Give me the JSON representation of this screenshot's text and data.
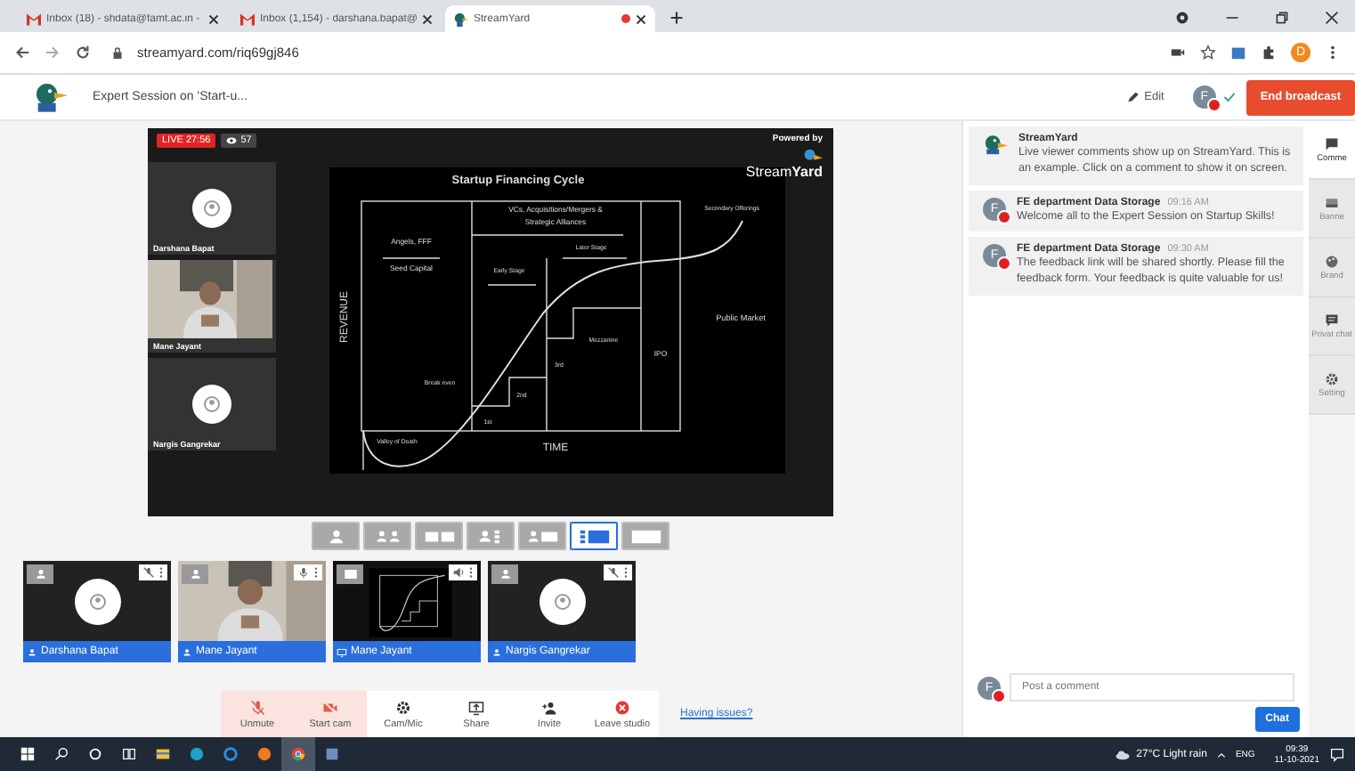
{
  "browser": {
    "tabs": [
      {
        "title": "Inbox (18) - shdata@famt.ac.in -",
        "kind": "mail",
        "selected": false,
        "recording": false
      },
      {
        "title": "Inbox (1,154) - darshana.bapat@",
        "kind": "mail",
        "selected": false,
        "recording": false
      },
      {
        "title": "StreamYard",
        "kind": "duck",
        "selected": true,
        "recording": true
      }
    ],
    "url": "streamyard.com/riq69gj846",
    "profile": "D"
  },
  "header": {
    "title": "Expert Session on 'Start-u...",
    "edit": "Edit",
    "avatar_initial": "F",
    "end_button": "End broadcast"
  },
  "stage": {
    "live": "LIVE 27:56",
    "viewers": "57",
    "powered_by": "Powered by",
    "brand": "Stream**Yard**",
    "participants": [
      {
        "name": "Darshana Bapat",
        "kind": "avatar"
      },
      {
        "name": "Mane Jayant",
        "kind": "video"
      },
      {
        "name": "Nargis Gangrekar",
        "kind": "avatar"
      }
    ],
    "slide": [
      "Startup Financing Cycle",
      "VCs, Acquisitions/Mergers &",
      "Strategic Alliances",
      "Angels, FFF",
      "Seed Capital",
      "Later Stage",
      "Early Stage",
      "REVENUE",
      "Secondary Offerings",
      "Public Market",
      "Mezzanine",
      "IPO",
      "3rd",
      "2nd",
      "Break even",
      "1st",
      "Valley of Death",
      "TIME"
    ]
  },
  "layouts": [
    {
      "kind": "solo",
      "selected": false
    },
    {
      "kind": "group",
      "selected": false
    },
    {
      "kind": "split",
      "selected": false
    },
    {
      "kind": "thin",
      "selected": false
    },
    {
      "kind": "leader",
      "selected": false
    },
    {
      "kind": "sidebar",
      "selected": true
    },
    {
      "kind": "full",
      "selected": false
    }
  ],
  "participants": [
    {
      "name": "Darshana Bapat",
      "kind": "avatar",
      "muted": true
    },
    {
      "name": "Mane Jayant",
      "kind": "video",
      "muted": false
    },
    {
      "name": "Mane Jayant",
      "kind": "screen",
      "muted": false
    },
    {
      "name": "Nargis Gangrekar",
      "kind": "avatar",
      "muted": true
    }
  ],
  "controls": [
    {
      "label": "Unmute",
      "kind": "mic-off",
      "alert": true
    },
    {
      "label": "Start cam",
      "kind": "cam-off",
      "alert": true
    },
    {
      "label": "Cam/Mic",
      "kind": "gear",
      "alert": false
    },
    {
      "label": "Share",
      "kind": "share",
      "alert": false
    },
    {
      "label": "Invite",
      "kind": "invite",
      "alert": false
    },
    {
      "label": "Leave studio",
      "kind": "leave",
      "alert": false
    }
  ],
  "help_link": "Having issues?",
  "chat": {
    "messages": [
      {
        "author": "StreamYard",
        "kind": "logo",
        "text": "Live viewer comments show up on StreamYard. This is an example. Click on a comment to show it on screen."
      },
      {
        "author": "FE department Data Storage",
        "time": "09:16 AM",
        "kind": "letter",
        "initial": "F",
        "text": "Welcome all to the Expert Session on Startup Skills!"
      },
      {
        "author": "FE department Data Storage",
        "time": "09:30 AM",
        "kind": "letter",
        "initial": "F",
        "text": "The feedback link will be shared shortly. Please fill the feedback form. Your feedback is quite valuable for us!"
      }
    ],
    "initial": "F",
    "placeholder": "Post a comment",
    "send": "Chat"
  },
  "side_nav": [
    {
      "label": "Comme",
      "kind": "comment",
      "selected": true
    },
    {
      "label": "Banne",
      "kind": "banner",
      "selected": false
    },
    {
      "label": "Brand",
      "kind": "palette",
      "selected": false
    },
    {
      "label": "Privat chat",
      "kind": "chat",
      "selected": false
    },
    {
      "label": "Setting",
      "kind": "gear",
      "selected": false
    }
  ],
  "taskbar": {
    "apps": [
      {
        "kind": "start",
        "selected": false
      },
      {
        "kind": "search",
        "selected": false
      },
      {
        "kind": "cortana",
        "selected": false
      },
      {
        "kind": "taskview",
        "selected": false
      },
      {
        "kind": "files",
        "selected": false
      },
      {
        "kind": "edge",
        "selected": false
      },
      {
        "kind": "ie",
        "selected": false
      },
      {
        "kind": "firefox",
        "selected": false
      },
      {
        "kind": "chrome",
        "selected": true
      },
      {
        "kind": "app",
        "selected": false
      }
    ],
    "weather": "27°C Light rain",
    "lang": "ENG",
    "time": "09:39",
    "date": "11-10-2021"
  }
}
